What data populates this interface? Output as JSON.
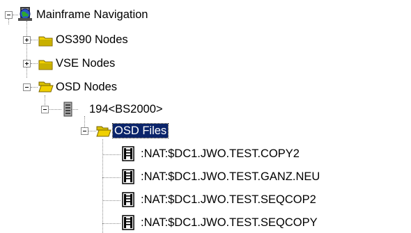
{
  "tree": {
    "root": {
      "label": "Mainframe Navigation",
      "icon": "mainframe-globe-icon"
    },
    "os390": {
      "label": "OS390 Nodes",
      "icon": "folder-closed-icon",
      "expander": "+"
    },
    "vse": {
      "label": "VSE Nodes",
      "icon": "folder-closed-icon",
      "expander": "+"
    },
    "osd": {
      "label": "OSD Nodes",
      "icon": "folder-open-icon",
      "expander": "-"
    },
    "bs2000": {
      "label": "194<BS2000>",
      "icon": "server-icon",
      "expander": "-"
    },
    "osd_files": {
      "label": "OSD Files",
      "icon": "folder-open-icon",
      "expander": "-",
      "selected": true
    },
    "files": [
      {
        "label": ":NAT:$DC1.JWO.TEST.COPY2",
        "icon": "file-icon"
      },
      {
        "label": ":NAT:$DC1.JWO.TEST.GANZ.NEU",
        "icon": "file-icon"
      },
      {
        "label": ":NAT:$DC1.JWO.TEST.SEQCOP2",
        "icon": "file-icon"
      },
      {
        "label": ":NAT:$DC1.JWO.TEST.SEQCOPY",
        "icon": "file-icon"
      }
    ]
  },
  "colors": {
    "selection": "#0a246a",
    "folder": "#f0d000",
    "tree_lines": "#8a8a8a"
  }
}
